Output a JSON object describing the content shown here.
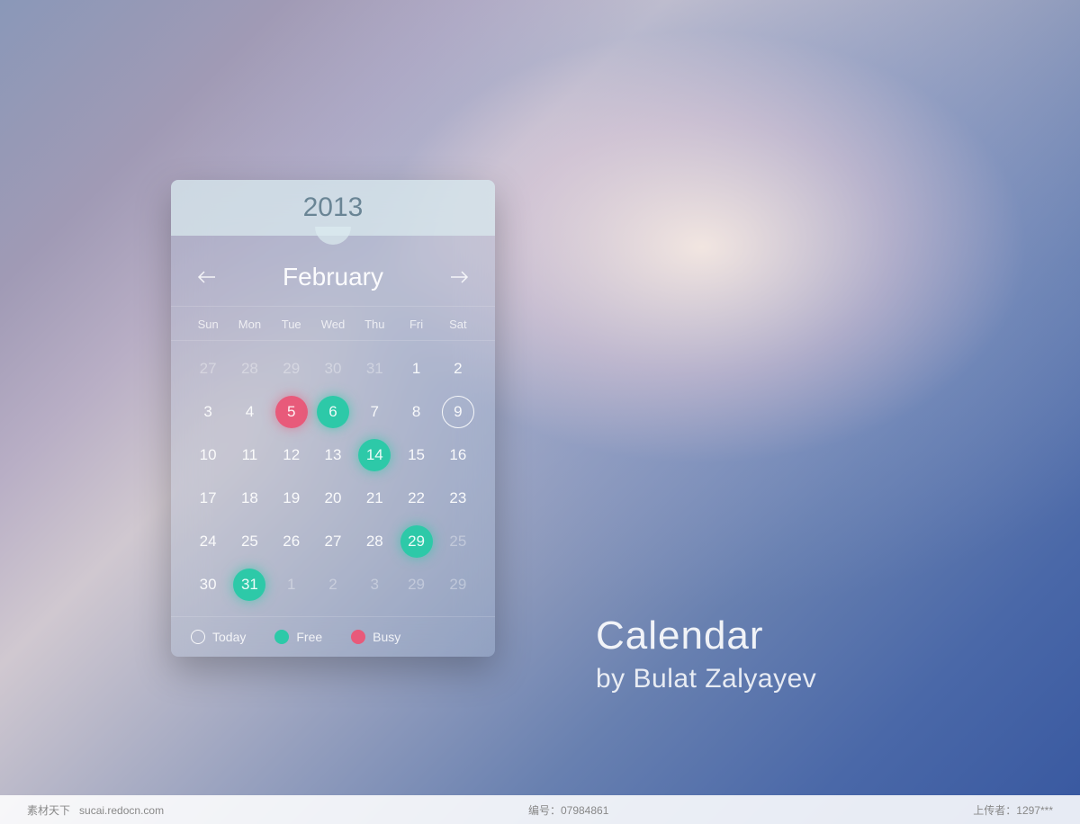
{
  "calendar": {
    "year": "2013",
    "month": "February",
    "weekdays": [
      "Sun",
      "Mon",
      "Tue",
      "Wed",
      "Thu",
      "Fri",
      "Sat"
    ],
    "days": [
      {
        "n": "27",
        "dim": true
      },
      {
        "n": "28",
        "dim": true
      },
      {
        "n": "29",
        "dim": true
      },
      {
        "n": "30",
        "dim": true
      },
      {
        "n": "31",
        "dim": true
      },
      {
        "n": "1"
      },
      {
        "n": "2"
      },
      {
        "n": "3"
      },
      {
        "n": "4"
      },
      {
        "n": "5",
        "status": "busy"
      },
      {
        "n": "6",
        "status": "free"
      },
      {
        "n": "7"
      },
      {
        "n": "8"
      },
      {
        "n": "9",
        "status": "today"
      },
      {
        "n": "10"
      },
      {
        "n": "11"
      },
      {
        "n": "12"
      },
      {
        "n": "13"
      },
      {
        "n": "14",
        "status": "free"
      },
      {
        "n": "15"
      },
      {
        "n": "16"
      },
      {
        "n": "17"
      },
      {
        "n": "18"
      },
      {
        "n": "19"
      },
      {
        "n": "20"
      },
      {
        "n": "21"
      },
      {
        "n": "22"
      },
      {
        "n": "23"
      },
      {
        "n": "24"
      },
      {
        "n": "25"
      },
      {
        "n": "26"
      },
      {
        "n": "27"
      },
      {
        "n": "28"
      },
      {
        "n": "29",
        "status": "free"
      },
      {
        "n": "25",
        "dim": true
      },
      {
        "n": "30"
      },
      {
        "n": "31",
        "status": "free"
      },
      {
        "n": "1",
        "dim": true
      },
      {
        "n": "2",
        "dim": true
      },
      {
        "n": "3",
        "dim": true
      },
      {
        "n": "29",
        "dim": true
      },
      {
        "n": "29",
        "dim": true
      }
    ],
    "legend": {
      "today": "Today",
      "free": "Free",
      "busy": "Busy"
    }
  },
  "title": {
    "main": "Calendar",
    "author": "by Bulat Zalyayev"
  },
  "footer": {
    "left_label": "素材天下",
    "left_url": "sucai.redocn.com",
    "center_label": "编号：",
    "center_id": "07984861",
    "right_label": "上传者：",
    "right_id": "1297***"
  },
  "colors": {
    "free": "#2dc9a8",
    "busy": "#e85a7a"
  }
}
